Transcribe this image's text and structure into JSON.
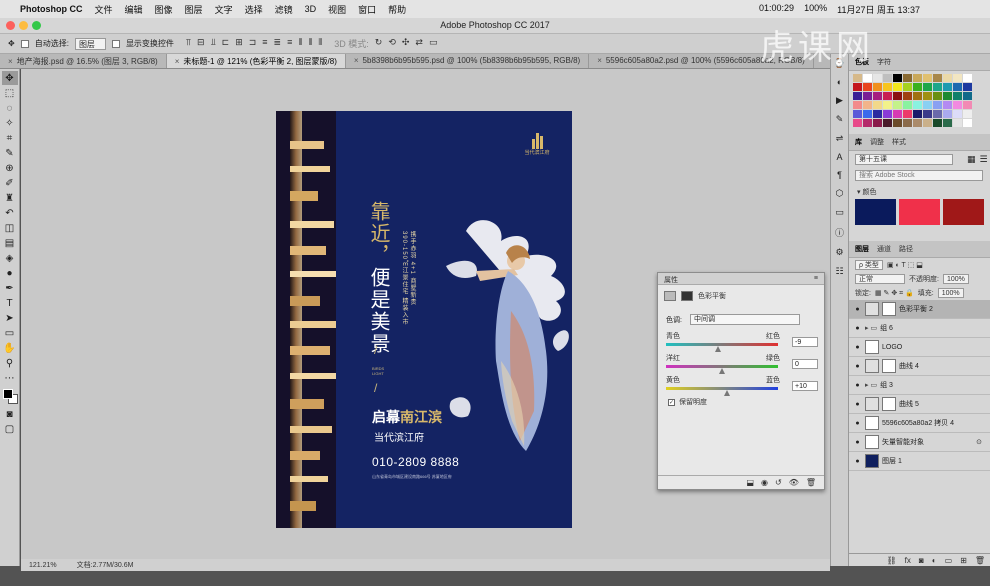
{
  "mac_menu": {
    "apple": "",
    "app": "Photoshop CC",
    "items": [
      "文件",
      "编辑",
      "图像",
      "图层",
      "文字",
      "选择",
      "滤镜",
      "3D",
      "视图",
      "窗口",
      "帮助"
    ],
    "status": [
      "01:00:29",
      "100%",
      "11月27日 周五 13:37"
    ]
  },
  "window": {
    "title": "Adobe Photoshop CC 2017"
  },
  "options": {
    "auto_select_label": "自动选择:",
    "auto_select_value": "图层",
    "show_transform_label": "显示变换控件",
    "mode_3d": "3D 模式:"
  },
  "doc_tabs": [
    {
      "label": "地产海报.psd @ 16.5% (图层 3, RGB/8)",
      "active": false
    },
    {
      "label": "未标题-1 @ 121% (色彩平衡 2, 图层蒙版/8)",
      "active": true
    },
    {
      "label": "5b8398b6b95b595.psd @ 100% (5b8398b6b95b595, RGB/8)",
      "active": false
    },
    {
      "label": "5596c605a80a2.psd @ 100% (5596c605a80a2, RGB/8)",
      "active": false
    }
  ],
  "tools": [
    "move",
    "marquee",
    "lasso",
    "magic-wand",
    "crop",
    "eyedropper",
    "healing",
    "brush",
    "stamp",
    "history-brush",
    "eraser",
    "gradient",
    "blur",
    "dodge",
    "pen",
    "type",
    "path-select",
    "shape",
    "hand",
    "zoom",
    "more"
  ],
  "poster": {
    "vertical_title": "靠近，便是美景",
    "vertical_title_gold": "靠近，",
    "vertical_title_white": "便是美景",
    "vertical_sub_1": "携手赤羽 4+1 商墅新贵",
    "vertical_sub_2": "390-150㎡江景住宅 精装入市",
    "english_1": "BIRDS",
    "english_2": "LIGHT",
    "headline_white": "启幕",
    "headline_gold": "南江滨",
    "subheadline": "当代滨江府",
    "phone": "010-2809 8888",
    "address": "山东省青岛市城区建设南路666号 苏厦地区府",
    "logo_text": "当代滨江府"
  },
  "properties_panel": {
    "title": "属性",
    "adjustment": "色彩平衡",
    "tone_label": "色调:",
    "tone_value": "中间调",
    "sliders": [
      {
        "left": "青色",
        "right": "红色",
        "value": "-9"
      },
      {
        "left": "洋红",
        "right": "绿色",
        "value": "0"
      },
      {
        "left": "黄色",
        "right": "蓝色",
        "value": "+10"
      }
    ],
    "preserve_label": "保留明度",
    "preserve_checked": true
  },
  "swatches_panel": {
    "tabs": [
      "色板",
      "字符"
    ],
    "colors": [
      "#d6b98a",
      "#ffffff",
      "#e6e6e6",
      "#bfbfbf",
      "#000000",
      "#8a6a32",
      "#c9a85a",
      "#e0c070",
      "#a8874a",
      "#ebd9a8",
      "#f2e6c2",
      "#ffffff",
      "#c4161c",
      "#e8451e",
      "#f0901e",
      "#f7c51e",
      "#f2e81e",
      "#a6d11e",
      "#3bb01e",
      "#1ea64a",
      "#1ea68a",
      "#1e9ab0",
      "#1e6ab0",
      "#1e3aa0",
      "#3a1e96",
      "#7a1e96",
      "#a61e80",
      "#c81e52",
      "#8a1010",
      "#a04010",
      "#a07010",
      "#a09010",
      "#6a9010",
      "#1e8a30",
      "#10806a",
      "#106a8a",
      "#f28a8a",
      "#f2b48a",
      "#f2d88a",
      "#f2f28a",
      "#c4f28a",
      "#8af2a0",
      "#8af2e0",
      "#8ad0f2",
      "#8aa0f2",
      "#b48af2",
      "#f28ae0",
      "#f28ab4",
      "#5a5ad8",
      "#3a6aec",
      "#2a2aa0",
      "#8a3ad8",
      "#d83ab4",
      "#ec3a6a",
      "#1a1a6a",
      "#3a3a8a",
      "#6a6aaa",
      "#aaaaee",
      "#dcdcf8",
      "#eeeeee",
      "#e84a8a",
      "#b42a6a",
      "#8a1a4a",
      "#4a1a2a",
      "#6a4a2a",
      "#8a6a4a",
      "#aa8a6a",
      "#cab08a",
      "#1a4a2a",
      "#2a6a4a",
      "#e4e4e4",
      "#ffffff"
    ]
  },
  "library_panel": {
    "tabs": [
      "库",
      "调整",
      "样式"
    ],
    "library_name": "第十五课",
    "search_placeholder": "搜索 Adobe Stock",
    "group_label": "颜色",
    "colors": [
      "#0a1a5c",
      "#f0304a",
      "#a01818"
    ]
  },
  "layers_panel": {
    "tabs": [
      "图层",
      "通道",
      "路径"
    ],
    "filter_label": "ρ 类型",
    "blend_mode": "正常",
    "opacity_label": "不透明度:",
    "opacity_value": "100%",
    "lock_label": "锁定:",
    "fill_label": "填充:",
    "fill_value": "100%",
    "layers": [
      {
        "name": "色彩平衡 2",
        "type": "adj",
        "selected": true,
        "fx": ""
      },
      {
        "name": "组 6",
        "type": "folder",
        "selected": false,
        "fx": ""
      },
      {
        "name": "LOGO",
        "type": "img",
        "selected": false,
        "fx": ""
      },
      {
        "name": "曲线 4",
        "type": "adj",
        "selected": false,
        "fx": ""
      },
      {
        "name": "组 3",
        "type": "folder",
        "selected": false,
        "fx": ""
      },
      {
        "name": "曲线 5",
        "type": "adj",
        "selected": false,
        "fx": ""
      },
      {
        "name": "5596c605a80a2 拷贝 4",
        "type": "img",
        "selected": false,
        "fx": ""
      },
      {
        "name": "矢量智能对象",
        "type": "img",
        "selected": false,
        "fx": "⊙"
      },
      {
        "name": "图层 1",
        "type": "dark",
        "selected": false,
        "fx": ""
      }
    ]
  },
  "status": {
    "zoom": "121.21%",
    "doc": "文档:2.77M/30.6M"
  },
  "watermark": "虎课网"
}
